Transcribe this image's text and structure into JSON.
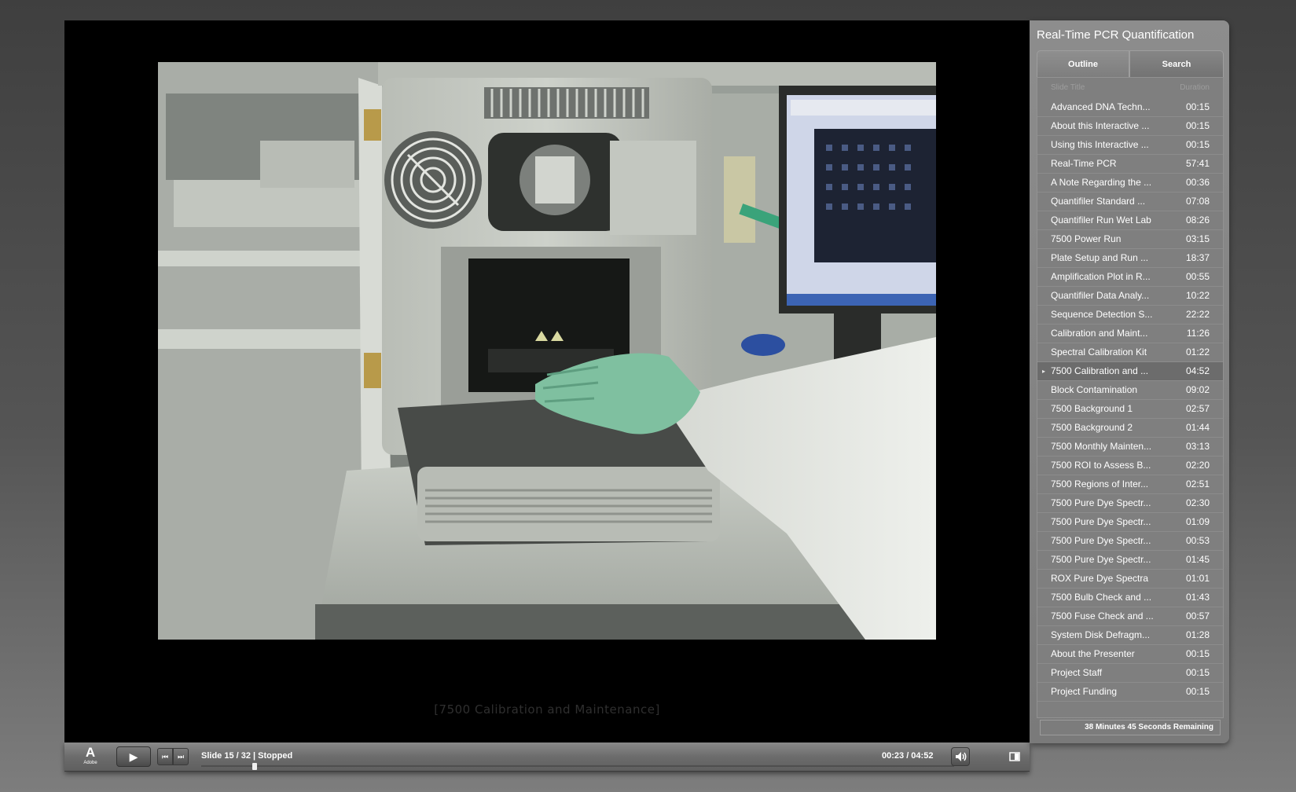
{
  "panel": {
    "title": "Real-Time PCR Quantification",
    "tabs": {
      "outline": "Outline",
      "search": "Search"
    },
    "columns": {
      "title": "Slide Title",
      "duration": "Duration"
    },
    "items": [
      {
        "title": "Advanced DNA Techn...",
        "duration": "00:15"
      },
      {
        "title": "About this Interactive ...",
        "duration": "00:15"
      },
      {
        "title": "Using this Interactive ...",
        "duration": "00:15"
      },
      {
        "title": "Real-Time PCR",
        "duration": "57:41"
      },
      {
        "title": "A Note Regarding the ...",
        "duration": "00:36"
      },
      {
        "title": "Quantifiler Standard ...",
        "duration": "07:08"
      },
      {
        "title": "Quantifiler Run Wet Lab",
        "duration": "08:26"
      },
      {
        "title": "7500 Power Run",
        "duration": "03:15"
      },
      {
        "title": "Plate Setup and Run ...",
        "duration": "18:37"
      },
      {
        "title": "Amplification Plot in R...",
        "duration": "00:55"
      },
      {
        "title": "Quantifiler Data Analy...",
        "duration": "10:22"
      },
      {
        "title": "Sequence Detection S...",
        "duration": "22:22"
      },
      {
        "title": "Calibration and Maint...",
        "duration": "11:26"
      },
      {
        "title": "Spectral Calibration Kit",
        "duration": "01:22"
      },
      {
        "title": "7500 Calibration and ...",
        "duration": "04:52",
        "current": true
      },
      {
        "title": "Block Contamination",
        "duration": "09:02"
      },
      {
        "title": "7500 Background 1",
        "duration": "02:57"
      },
      {
        "title": "7500 Background 2",
        "duration": "01:44"
      },
      {
        "title": "7500 Monthly Mainten...",
        "duration": "03:13"
      },
      {
        "title": "7500 ROI to Assess B...",
        "duration": "02:20"
      },
      {
        "title": "7500 Regions of Inter...",
        "duration": "02:51"
      },
      {
        "title": "7500 Pure Dye Spectr...",
        "duration": "02:30"
      },
      {
        "title": "7500 Pure Dye Spectr...",
        "duration": "01:09"
      },
      {
        "title": "7500 Pure Dye Spectr...",
        "duration": "00:53"
      },
      {
        "title": "7500 Pure Dye Spectr...",
        "duration": "01:45"
      },
      {
        "title": "ROX Pure Dye Spectra",
        "duration": "01:01"
      },
      {
        "title": "7500 Bulb Check and ...",
        "duration": "01:43"
      },
      {
        "title": "7500 Fuse Check and ...",
        "duration": "00:57"
      },
      {
        "title": "System Disk Defragm...",
        "duration": "01:28"
      },
      {
        "title": "About the Presenter",
        "duration": "00:15"
      },
      {
        "title": "Project Staff",
        "duration": "00:15"
      },
      {
        "title": "Project Funding",
        "duration": "00:15"
      }
    ],
    "current_marker": "▸",
    "remaining": "38 Minutes 45 Seconds Remaining"
  },
  "player": {
    "caption": "[7500 Calibration and Maintenance]",
    "controls": {
      "logo_mark": "A",
      "logo_word": "Adobe",
      "play_glyph": "▶",
      "prev_glyph": "⏮",
      "next_glyph": "⏭",
      "slide_status": "Slide 15 / 32 | Stopped",
      "time": "00:23 / 04:52",
      "progress_fraction": 0.068
    }
  },
  "icons": {
    "play": "play-icon",
    "prev": "previous-slide-icon",
    "next": "next-slide-icon",
    "volume": "speaker-icon",
    "toc_toggle": "panel-toggle-icon",
    "logo": "adobe-logo-icon"
  },
  "colors": {
    "stage": "#000000",
    "panel": "#808080",
    "current_row": "#6c6c6c",
    "glove": "#7fc0a0"
  }
}
